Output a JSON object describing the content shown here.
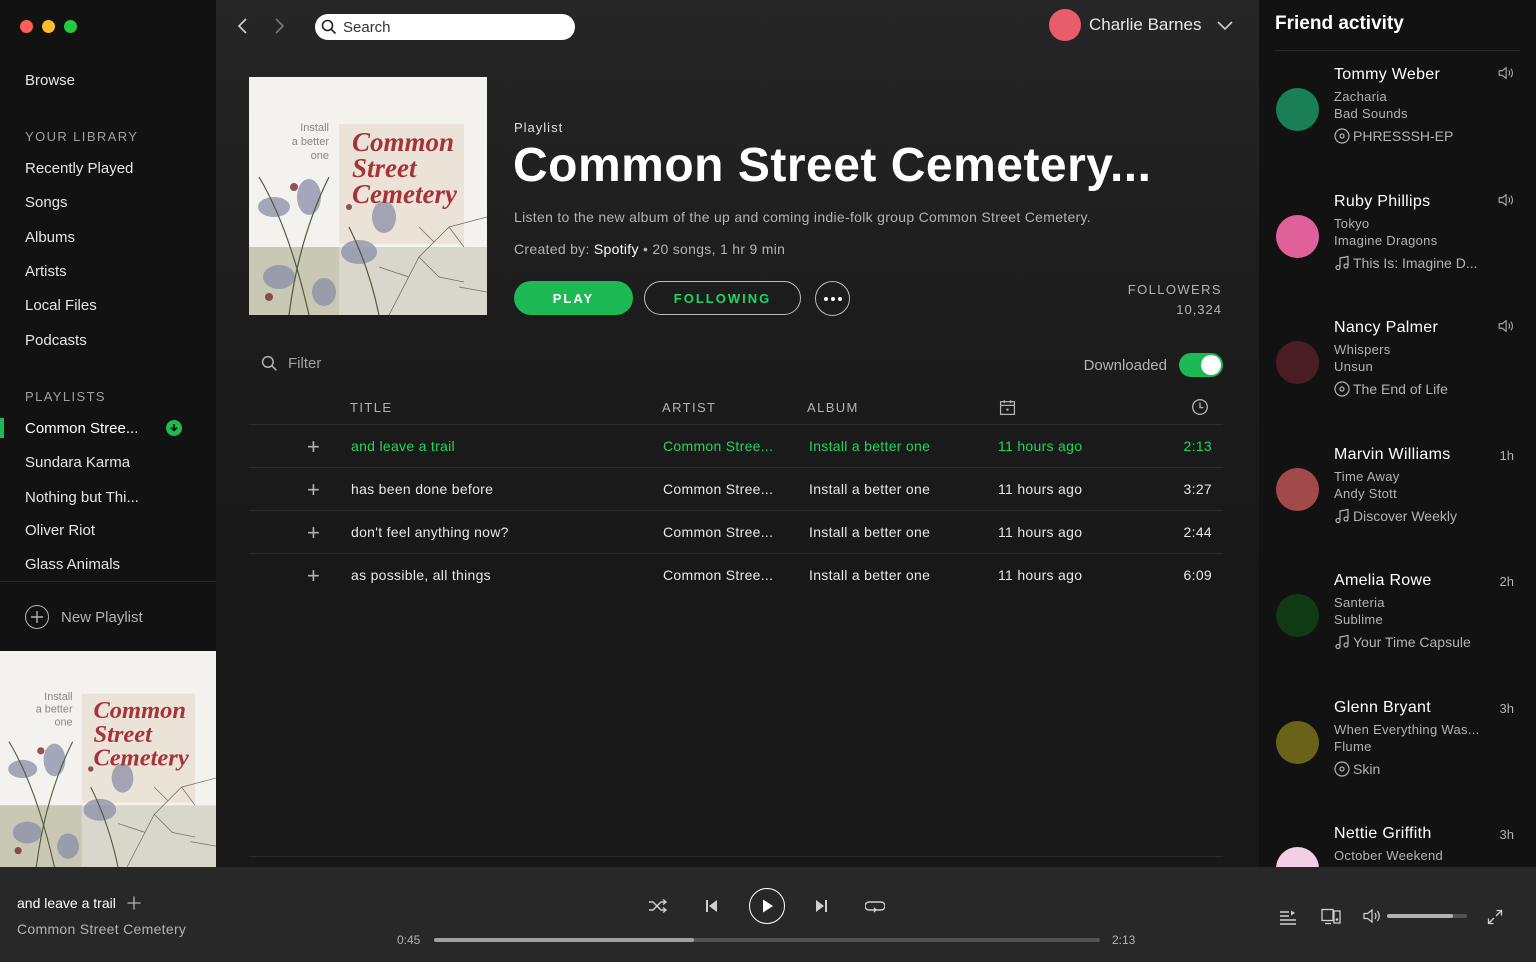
{
  "window": {
    "traffic_colors": [
      "#ff5f57",
      "#febc2e",
      "#28c840"
    ]
  },
  "sidebar": {
    "browse": "Browse",
    "library_label": "YOUR LIBRARY",
    "library": [
      "Recently Played",
      "Songs",
      "Albums",
      "Artists",
      "Local Files",
      "Podcasts"
    ],
    "playlists_label": "PLAYLISTS",
    "playlists": [
      "Common Stree...",
      "Sundara Karma",
      "Nothing but Thi...",
      "Oliver Riot",
      "Glass Animals"
    ],
    "active_playlist_index": 0,
    "new_playlist": "New Playlist"
  },
  "cover_art": {
    "small_text": [
      "Install",
      "a better",
      "one"
    ],
    "title_lines": [
      "Common",
      "Street",
      "Cemetery"
    ]
  },
  "topbar": {
    "search_placeholder": "Search",
    "user_name": "Charlie Barnes",
    "user_color": "#e95d6a"
  },
  "playlist": {
    "type": "Playlist",
    "title": "Common Street Cemetery...",
    "description": "Listen to the new album of the up and coming indie-folk group Common Street Cemetery.",
    "created_by_label": "Created by:",
    "creator": "Spotify",
    "stats": "• 20 songs, 1 hr 9 min",
    "play_label": "PLAY",
    "following_label": "FOLLOWING",
    "followers_label": "FOLLOWERS",
    "followers_count": "10,324"
  },
  "filter": {
    "placeholder": "Filter",
    "downloaded_label": "Downloaded",
    "downloaded_on": true
  },
  "tracks": {
    "columns": {
      "title": "TITLE",
      "artist": "ARTIST",
      "album": "ALBUM"
    },
    "rows": [
      {
        "title": "and leave a trail",
        "artist": "Common Stree...",
        "album": "Install a better one",
        "added": "11 hours ago",
        "duration": "2:13",
        "playing": true
      },
      {
        "title": "has been done before",
        "artist": "Common Stree...",
        "album": "Install a better one",
        "added": "11 hours ago",
        "duration": "3:27",
        "playing": false
      },
      {
        "title": "don't feel anything now?",
        "artist": "Common Stree...",
        "album": "Install a better one",
        "added": "11 hours ago",
        "duration": "2:44",
        "playing": false
      },
      {
        "title": "as possible, all things",
        "artist": "Common Stree...",
        "album": "Install a better one",
        "added": "11 hours ago",
        "duration": "6:09",
        "playing": false
      }
    ]
  },
  "friends": {
    "title": "Friend activity",
    "list": [
      {
        "name": "Tommy Weber",
        "track": "Zacharia",
        "artist": "Bad Sounds",
        "context": "PHRESSSH-EP",
        "context_icon": "album-icon",
        "time": "",
        "listening": true,
        "color": "#1a7f56"
      },
      {
        "name": "Ruby Phillips",
        "track": "Tokyo",
        "artist": "Imagine Dragons",
        "context": "This Is: Imagine D...",
        "context_icon": "playlist-icon",
        "time": "",
        "listening": true,
        "color": "#e0609a"
      },
      {
        "name": "Nancy Palmer",
        "track": "Whispers",
        "artist": "Unsun",
        "context": "The End of Life",
        "context_icon": "album-icon",
        "time": "",
        "listening": true,
        "color": "#4a1d22"
      },
      {
        "name": "Marvin Williams",
        "track": "Time Away",
        "artist": "Andy Stott",
        "context": "Discover Weekly",
        "context_icon": "playlist-icon",
        "time": "1h",
        "listening": false,
        "color": "#a24a4a"
      },
      {
        "name": "Amelia Rowe",
        "track": "Santeria",
        "artist": "Sublime",
        "context": "Your Time Capsule",
        "context_icon": "playlist-icon",
        "time": "2h",
        "listening": false,
        "color": "#0f3a14"
      },
      {
        "name": "Glenn Bryant",
        "track": "When Everything Was...",
        "artist": "Flume",
        "context": "Skin",
        "context_icon": "album-icon",
        "time": "3h",
        "listening": false,
        "color": "#6b6219"
      },
      {
        "name": "Nettie Griffith",
        "track": "October Weekend",
        "artist": "",
        "context": "",
        "context_icon": "",
        "time": "3h",
        "listening": false,
        "color": "#f2cfe4"
      }
    ]
  },
  "player": {
    "track": "and leave a trail",
    "artist": "Common Street Cemetery",
    "elapsed": "0:45",
    "total": "2:13",
    "progress": 0.39,
    "volume": 0.82
  }
}
